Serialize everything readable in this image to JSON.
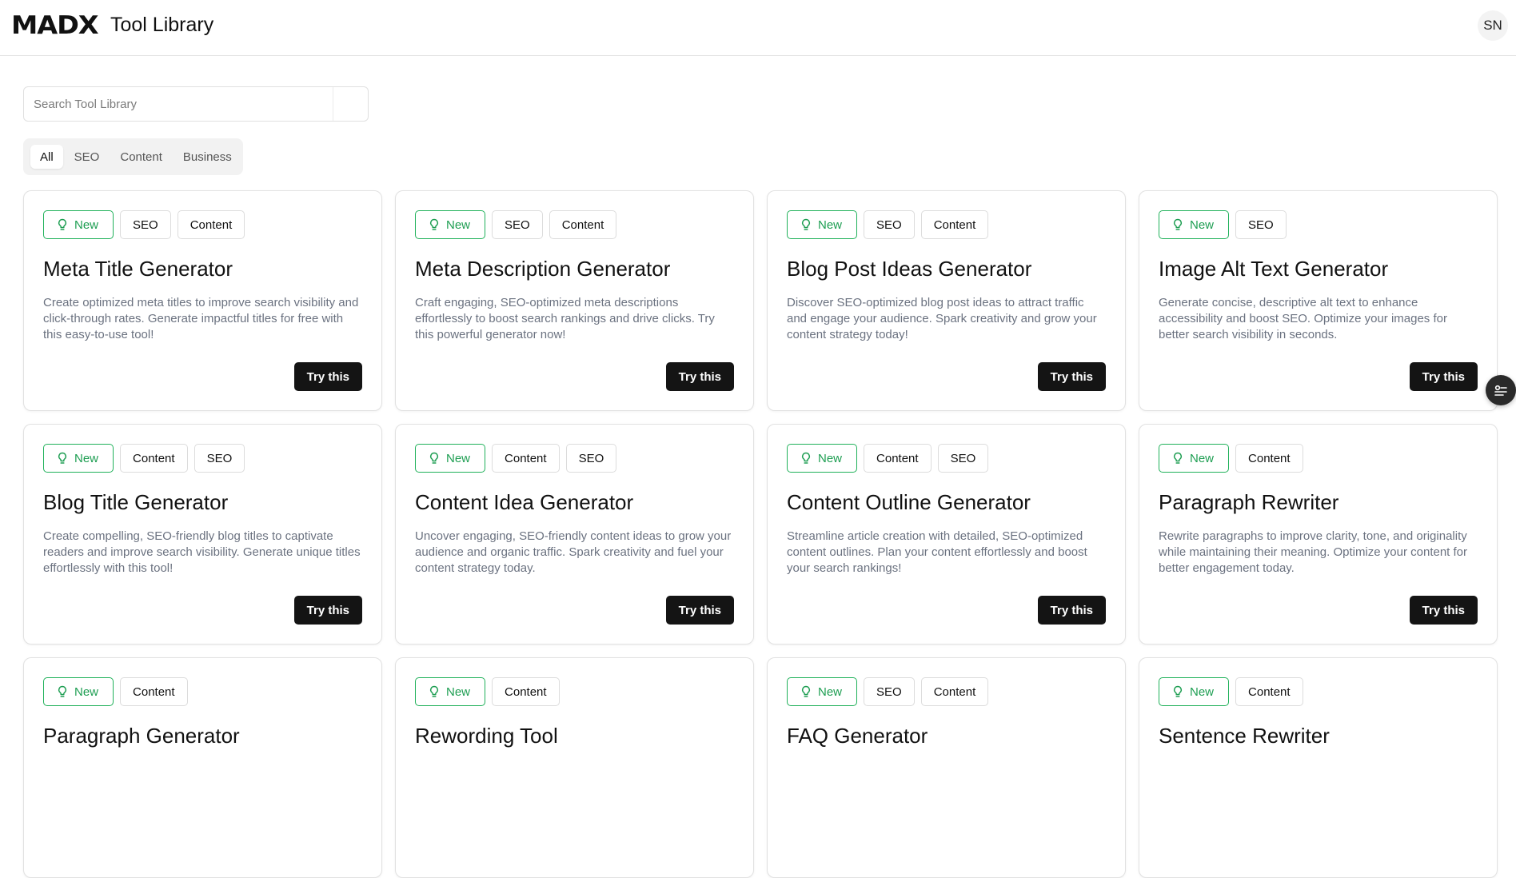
{
  "header": {
    "logo": "MADX",
    "title": "Tool Library",
    "avatar_initials": "SN"
  },
  "search": {
    "placeholder": "Search Tool Library",
    "value": ""
  },
  "filters": {
    "tabs": [
      {
        "label": "All",
        "active": true
      },
      {
        "label": "SEO",
        "active": false
      },
      {
        "label": "Content",
        "active": false
      },
      {
        "label": "Business",
        "active": false
      }
    ]
  },
  "colors": {
    "accent_new": "#1e9e52",
    "button_bg": "#141414"
  },
  "cards": [
    {
      "badge": "New",
      "tags": [
        "SEO",
        "Content"
      ],
      "title": "Meta Title Generator",
      "description": "Create optimized meta titles to improve search visibility and click-through rates. Generate impactful titles for free with this easy-to-use tool!",
      "button": "Try this"
    },
    {
      "badge": "New",
      "tags": [
        "SEO",
        "Content"
      ],
      "title": "Meta Description Generator",
      "description": "Craft engaging, SEO-optimized meta descriptions effortlessly to boost search rankings and drive clicks. Try this powerful generator now!",
      "button": "Try this"
    },
    {
      "badge": "New",
      "tags": [
        "SEO",
        "Content"
      ],
      "title": "Blog Post Ideas Generator",
      "description": "Discover SEO-optimized blog post ideas to attract traffic and engage your audience. Spark creativity and grow your content strategy today!",
      "button": "Try this"
    },
    {
      "badge": "New",
      "tags": [
        "SEO"
      ],
      "title": "Image Alt Text Generator",
      "description": "Generate concise, descriptive alt text to enhance accessibility and boost SEO. Optimize your images for better search visibility in seconds.",
      "button": "Try this"
    },
    {
      "badge": "New",
      "tags": [
        "Content",
        "SEO"
      ],
      "title": "Blog Title Generator",
      "description": "Create compelling, SEO-friendly blog titles to captivate readers and improve search visibility. Generate unique titles effortlessly with this tool!",
      "button": "Try this"
    },
    {
      "badge": "New",
      "tags": [
        "Content",
        "SEO"
      ],
      "title": "Content Idea Generator",
      "description": "Uncover engaging, SEO-friendly content ideas to grow your audience and organic traffic. Spark creativity and fuel your content strategy today.",
      "button": "Try this"
    },
    {
      "badge": "New",
      "tags": [
        "Content",
        "SEO"
      ],
      "title": "Content Outline Generator",
      "description": "Streamline article creation with detailed, SEO-optimized content outlines. Plan your content effortlessly and boost your search rankings!",
      "button": "Try this"
    },
    {
      "badge": "New",
      "tags": [
        "Content"
      ],
      "title": "Paragraph Rewriter",
      "description": "Rewrite paragraphs to improve clarity, tone, and originality while maintaining their meaning. Optimize your content for better engagement today.",
      "button": "Try this"
    },
    {
      "badge": "New",
      "tags": [
        "Content"
      ],
      "title": "Paragraph Generator",
      "description": "",
      "button": ""
    },
    {
      "badge": "New",
      "tags": [
        "Content"
      ],
      "title": "Rewording Tool",
      "description": "",
      "button": ""
    },
    {
      "badge": "New",
      "tags": [
        "SEO",
        "Content"
      ],
      "title": "FAQ Generator",
      "description": "",
      "button": ""
    },
    {
      "badge": "New",
      "tags": [
        "Content"
      ],
      "title": "Sentence Rewriter",
      "description": "",
      "button": ""
    }
  ]
}
